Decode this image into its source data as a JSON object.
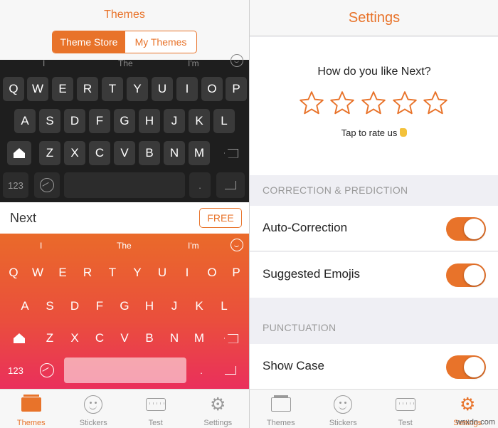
{
  "left": {
    "title": "Themes",
    "segments": [
      "Theme Store",
      "My Themes"
    ],
    "dark_keyboard": {
      "suggestions": [
        "I",
        "The",
        "I'm"
      ],
      "rows": [
        [
          "Q",
          "W",
          "E",
          "R",
          "T",
          "Y",
          "U",
          "I",
          "O",
          "P"
        ],
        [
          "A",
          "S",
          "D",
          "F",
          "G",
          "H",
          "J",
          "K",
          "L"
        ],
        [
          "Z",
          "X",
          "C",
          "V",
          "B",
          "N",
          "M"
        ]
      ],
      "numbers_key": "123",
      "period_key": "."
    },
    "theme_name": "Next",
    "free_label": "FREE",
    "orange_keyboard": {
      "suggestions": [
        "I",
        "The",
        "I'm"
      ],
      "rows": [
        [
          "Q",
          "W",
          "E",
          "R",
          "T",
          "Y",
          "U",
          "I",
          "O",
          "P"
        ],
        [
          "A",
          "S",
          "D",
          "F",
          "G",
          "H",
          "J",
          "K",
          "L"
        ],
        [
          "Z",
          "X",
          "C",
          "V",
          "B",
          "N",
          "M"
        ]
      ],
      "numbers_key": "123",
      "period_key": "."
    },
    "tabs": [
      "Themes",
      "Stickers",
      "Test",
      "Settings"
    ],
    "active_tab": "Themes"
  },
  "right": {
    "title": "Settings",
    "rate_question": "How do you like Next?",
    "rate_hint": "Tap to rate us",
    "star_count": 5,
    "sections": [
      {
        "header": "CORRECTION & PREDICTION",
        "items": [
          {
            "label": "Auto-Correction",
            "on": true
          },
          {
            "label": "Suggested Emojis",
            "on": true
          }
        ]
      },
      {
        "header": "PUNCTUATION",
        "items": [
          {
            "label": "Show Case",
            "on": true
          }
        ]
      }
    ],
    "tabs": [
      "Themes",
      "Stickers",
      "Test",
      "Settings"
    ],
    "active_tab": "Settings",
    "watermark": "wsxdn.com"
  },
  "colors": {
    "accent": "#e8732a",
    "dark_key": "#3a3a3a"
  }
}
